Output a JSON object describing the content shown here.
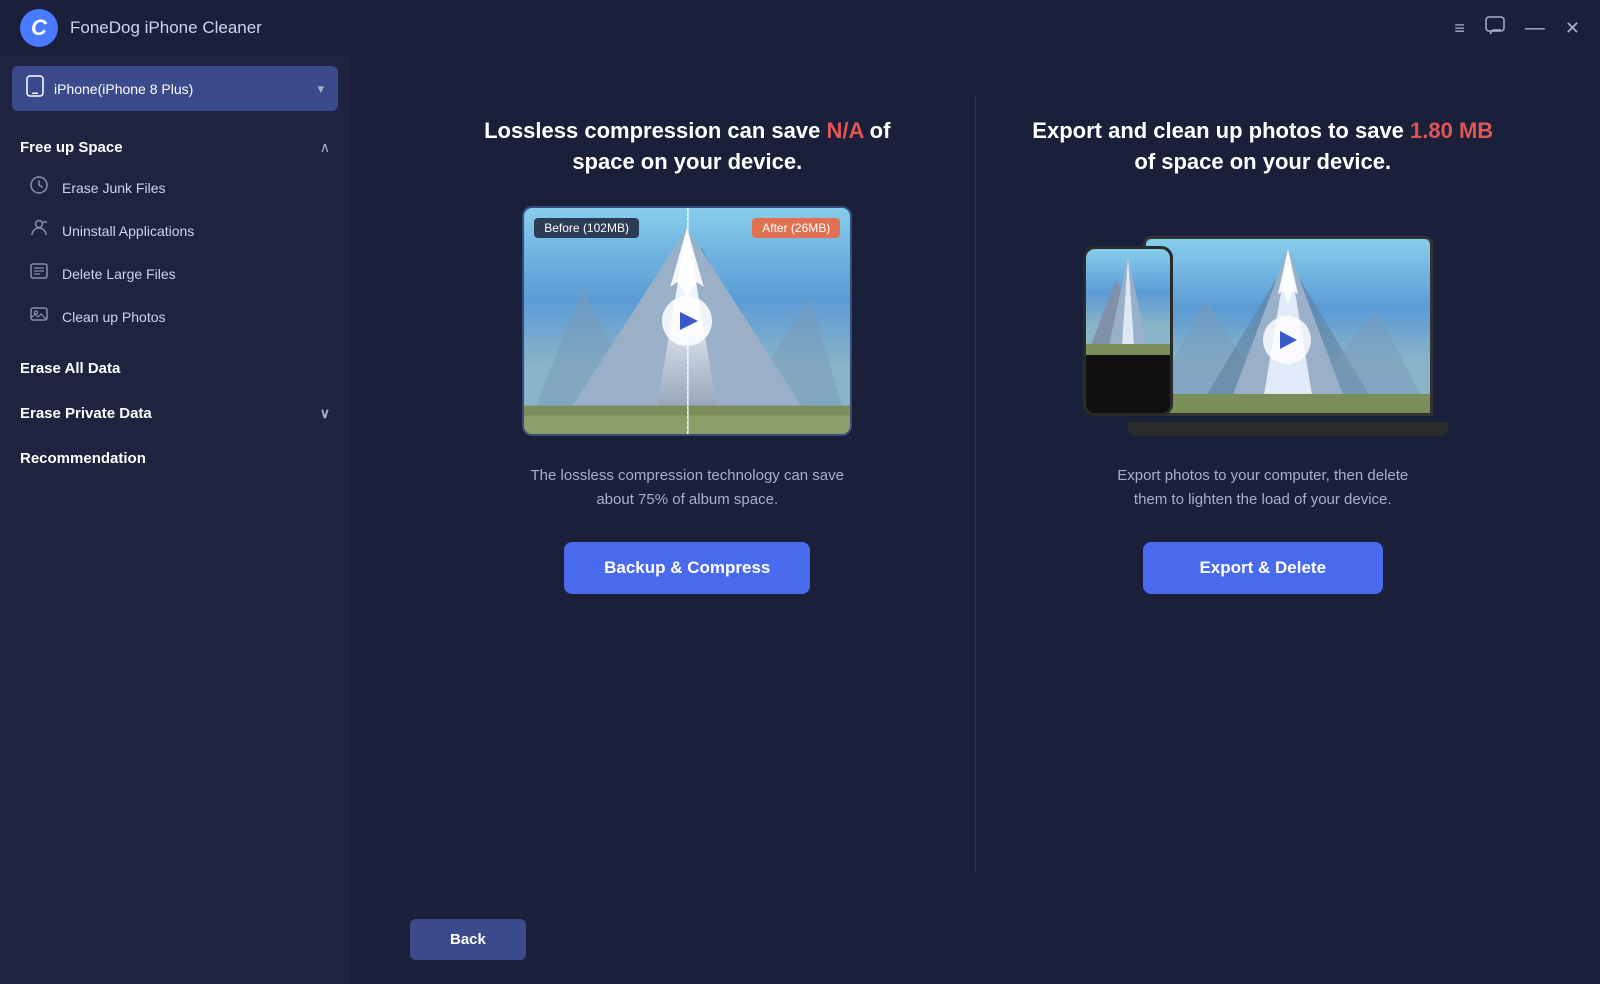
{
  "titleBar": {
    "appName": "FoneDog iPhone Cleaner",
    "logoText": "C",
    "controls": {
      "menu": "≡",
      "chat": "💬",
      "minimize": "—",
      "close": "✕"
    }
  },
  "deviceSelector": {
    "label": "iPhone(iPhone 8 Plus)",
    "icon": "📱"
  },
  "sidebar": {
    "sections": [
      {
        "title": "Free up Space",
        "expanded": true,
        "items": [
          {
            "label": "Erase Junk Files",
            "icon": "clock"
          },
          {
            "label": "Uninstall Applications",
            "icon": "person"
          },
          {
            "label": "Delete Large Files",
            "icon": "list"
          },
          {
            "label": "Clean up Photos",
            "icon": "photo"
          }
        ]
      }
    ],
    "menuItems": [
      {
        "label": "Erase All Data",
        "hasArrow": false
      },
      {
        "label": "Erase Private Data",
        "hasArrow": true
      },
      {
        "label": "Recommendation",
        "hasArrow": false
      }
    ]
  },
  "compressionCard": {
    "headline_part1": "Lossless compression can save ",
    "headline_highlight": "N/A",
    "headline_part2": " of space on your device.",
    "before_label": "Before (102MB)",
    "after_label": "After (26MB)",
    "description": "The lossless compression technology can save about 75% of album space.",
    "button_label": "Backup & Compress"
  },
  "exportCard": {
    "headline_part1": "Export and clean up photos to save ",
    "headline_highlight": "1.80 MB",
    "headline_part2": " of space on your device.",
    "description": "Export photos to your computer, then delete them to lighten the load of your device.",
    "button_label": "Export & Delete"
  },
  "footer": {
    "back_label": "Back"
  }
}
